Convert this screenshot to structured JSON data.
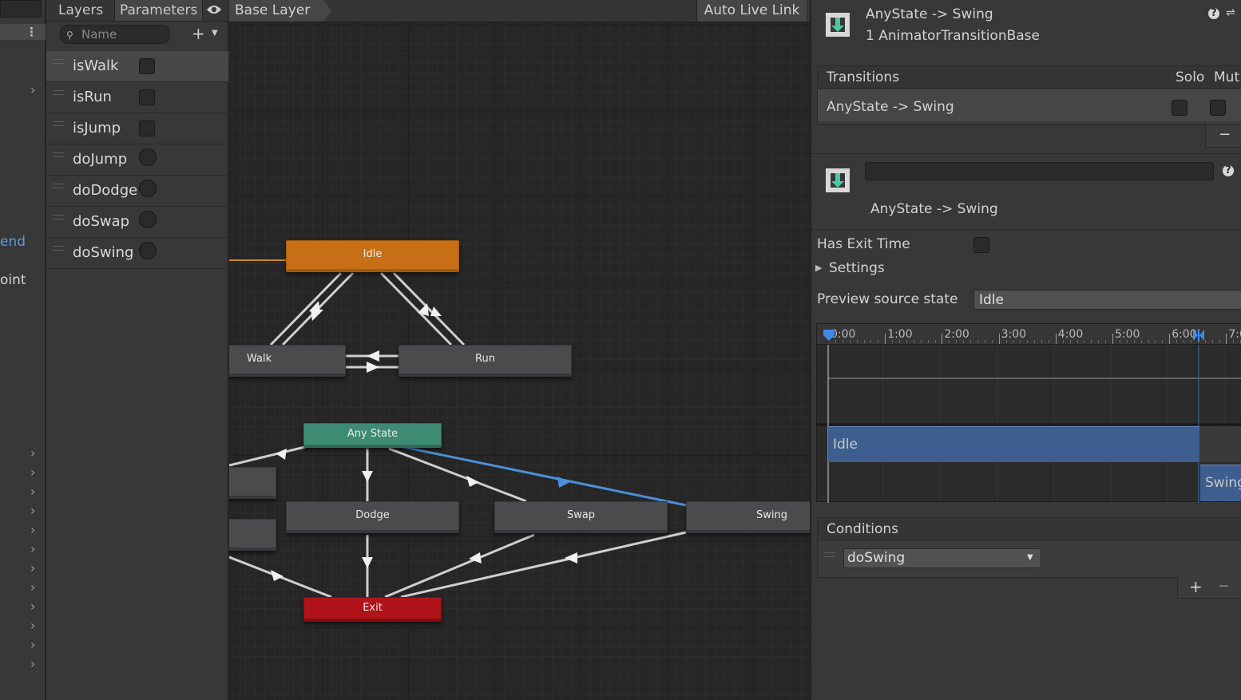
{
  "left_strip": {
    "link_1": "end",
    "link_2": "oint"
  },
  "params_panel": {
    "tab_layers": "Layers",
    "tab_parameters": "Parameters",
    "search_placeholder": "Name",
    "add_symbol": "+",
    "parameters": [
      {
        "name": "isWalk",
        "type": "bool"
      },
      {
        "name": "isRun",
        "type": "bool"
      },
      {
        "name": "isJump",
        "type": "bool"
      },
      {
        "name": "doJump",
        "type": "trigger"
      },
      {
        "name": "doDodge",
        "type": "trigger"
      },
      {
        "name": "doSwap",
        "type": "trigger"
      },
      {
        "name": "doSwing",
        "type": "trigger"
      }
    ]
  },
  "graph": {
    "breadcrumb": "Base Layer",
    "auto_live_link": "Auto Live Link",
    "nodes": {
      "idle": "Idle",
      "walk": "Walk",
      "run": "Run",
      "any_state": "Any State",
      "dodge": "Dodge",
      "swap": "Swap",
      "swing": "Swing",
      "exit": "Exit"
    },
    "colors": {
      "idle": "#c76f16",
      "any_state": "#3e8b74",
      "exit": "#b0141a",
      "selected_transition": "#4a90d9",
      "transition": "#d0d0d0"
    }
  },
  "inspector": {
    "header_title": "AnyState -> Swing",
    "header_subtitle": "1 AnimatorTransitionBase",
    "transitions_label": "Transitions",
    "solo_label": "Solo",
    "mute_label": "Mut",
    "transition_row": "AnyState -> Swing",
    "remove_symbol": "−",
    "transition_name": "AnyState -> Swing",
    "has_exit_time_label": "Has Exit Time",
    "settings_label": "Settings",
    "preview_label": "Preview source state",
    "preview_value": "Idle",
    "timeline_ticks": [
      "0:00",
      "1:00",
      "2:00",
      "3:00",
      "4:00",
      "5:00",
      "6:00",
      "7:0"
    ],
    "timeline_idle": "Idle",
    "timeline_swing": "Swing",
    "conditions_label": "Conditions",
    "condition_value": "doSwing",
    "add_symbol": "+",
    "remove_cond_symbol": "−"
  }
}
